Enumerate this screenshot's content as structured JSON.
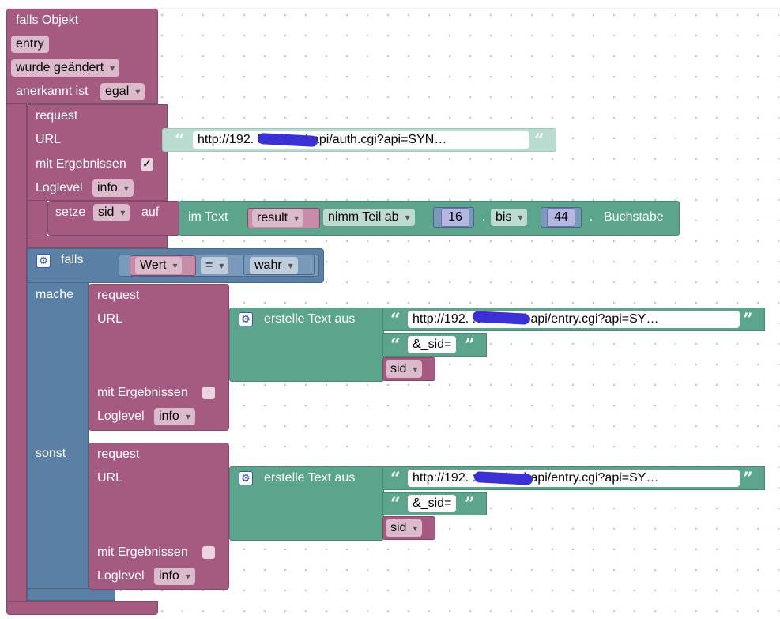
{
  "trigger": {
    "title": "falls Objekt",
    "object": "entry",
    "changed": "wurde geändert",
    "ack_label": "anerkannt ist",
    "ack_value": "egal"
  },
  "req1": {
    "label": "request",
    "url_label": "URL",
    "url_value": "http://192.          5000/webapi/auth.cgi?api=SYN…",
    "results_label": "mit Ergebnissen",
    "results_checked": "✓",
    "loglevel_label": "Loglevel",
    "loglevel_value": "info"
  },
  "setze": {
    "label": "setze",
    "var": "sid",
    "to": "auf",
    "intext": "im Text",
    "result": "result",
    "take": "nimm Teil ab",
    "from": "16",
    "bis": "bis",
    "to_num": "44",
    "letter": "Buchstabe",
    "dot": "."
  },
  "ifblock": {
    "falls": "falls",
    "wert": "Wert",
    "op": "=",
    "wahr": "wahr",
    "mache": "mache",
    "sonst": "sonst"
  },
  "req2": {
    "label": "request",
    "url_label": "URL",
    "join_label": "erstelle Text aus",
    "url_value": "http://192.          :5000/webapi/entry.cgi?api=SY…",
    "sid_text": "&_sid=",
    "sid_var": "sid",
    "results_label": "mit Ergebnissen",
    "loglevel_label": "Loglevel",
    "loglevel_value": "info"
  },
  "req3": {
    "label": "request",
    "url_label": "URL",
    "join_label": "erstelle Text aus",
    "url_value": "http://192.          :5000/webapi/entry.cgi?api=SY…",
    "sid_text": "&_sid=",
    "sid_var": "sid",
    "results_label": "mit Ergebnissen",
    "loglevel_label": "Loglevel",
    "loglevel_value": "info"
  },
  "quotes": {
    "open": "“",
    "close": "”"
  },
  "icons": {
    "gear": "gear-icon",
    "checkbox": "checkbox-icon",
    "dropdown": "dropdown-arrow-icon"
  },
  "colors": {
    "procedure": "#a55b80",
    "text": "#5ba58c",
    "logic": "#5b80a5",
    "url_literal": "#b8dccf"
  }
}
